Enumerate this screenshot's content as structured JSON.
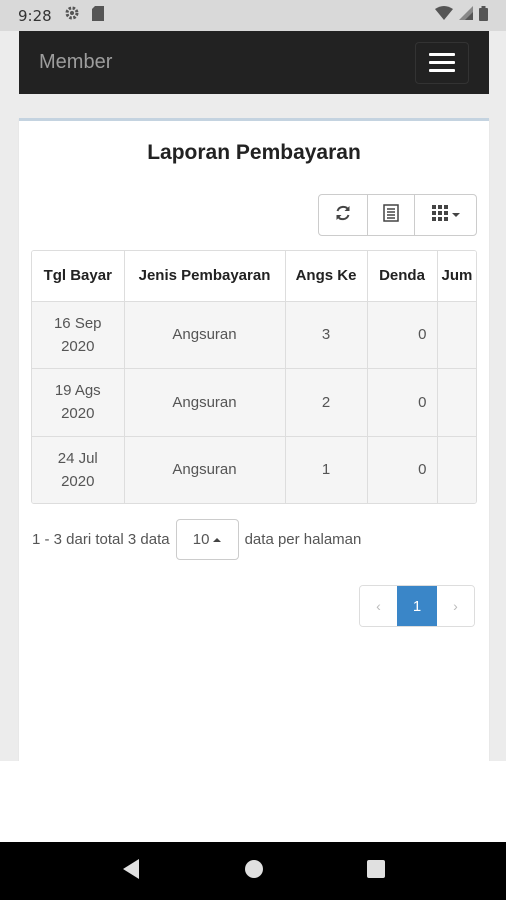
{
  "status_bar": {
    "time": "9:28",
    "icons": [
      "gear-icon",
      "sd-card-icon",
      "wifi-icon",
      "cell-signal-icon",
      "battery-icon"
    ]
  },
  "navbar": {
    "brand": "Member",
    "menu_icon": "hamburger-icon"
  },
  "panel": {
    "title": "Laporan Pembayaran"
  },
  "toolbar": {
    "buttons": [
      "refresh-icon",
      "toggle-view-icon",
      "columns-grid-icon"
    ]
  },
  "table": {
    "columns": [
      "Tgl Bayar",
      "Jenis Pembayaran",
      "Angs Ke",
      "Denda",
      "Jum"
    ],
    "rows": [
      {
        "tgl_line1": "16 Sep",
        "tgl_line2": "2020",
        "jenis": "Angsuran",
        "angs_ke": "3",
        "denda": "0",
        "jumlah": ""
      },
      {
        "tgl_line1": "19 Ags",
        "tgl_line2": "2020",
        "jenis": "Angsuran",
        "angs_ke": "2",
        "denda": "0",
        "jumlah": ""
      },
      {
        "tgl_line1": "24 Jul",
        "tgl_line2": "2020",
        "jenis": "Angsuran",
        "angs_ke": "1",
        "denda": "0",
        "jumlah": ""
      }
    ]
  },
  "pagination": {
    "info": "1 - 3 dari total 3 data",
    "page_size": "10",
    "per_page_label": "data per halaman",
    "prev": "‹",
    "current": "1",
    "next": "›"
  },
  "colors": {
    "navbar_bg": "#222222",
    "active_page": "#3a86c8",
    "panel_border": "#c4d3e0"
  }
}
